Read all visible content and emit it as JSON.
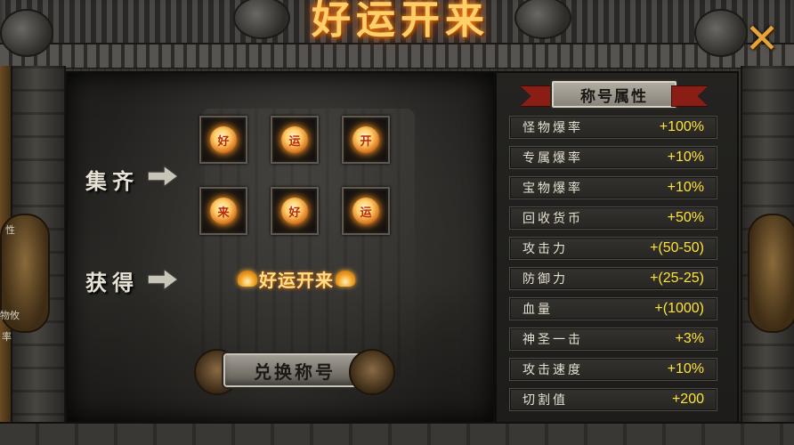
{
  "window": {
    "title": "好运开来",
    "close_icon": "close-x-icon"
  },
  "left": {
    "collect_label": "集齐",
    "obtain_label": "获得",
    "collect_items": [
      {
        "glyph": "好"
      },
      {
        "glyph": "运"
      },
      {
        "glyph": "开"
      },
      {
        "glyph": "来"
      },
      {
        "glyph": "好"
      },
      {
        "glyph": "运"
      }
    ],
    "reward_title": "好运开来",
    "exchange_button": "兑换称号"
  },
  "attributes": {
    "header": "称号属性",
    "rows": [
      {
        "name": "怪物爆率",
        "value": "+100%"
      },
      {
        "name": "专属爆率",
        "value": "+10%"
      },
      {
        "name": "宝物爆率",
        "value": "+10%"
      },
      {
        "name": "回收货币",
        "value": "+50%"
      },
      {
        "name": "攻击力",
        "value": "+(50-50)"
      },
      {
        "name": "防御力",
        "value": "+(25-25)"
      },
      {
        "name": "血量",
        "value": "+(1000)"
      },
      {
        "name": "神圣一击",
        "value": "+3%"
      },
      {
        "name": "攻击速度",
        "value": "+10%"
      },
      {
        "name": "切割值",
        "value": "+200"
      }
    ]
  },
  "background_fragments": {
    "side_text_1": "性",
    "side_text_2": "物攸",
    "side_text_3": "率"
  },
  "colors": {
    "value_yellow": "#ffe23a",
    "title_gold": "#ffcf6a",
    "ribbon_red": "#8a1e14"
  }
}
